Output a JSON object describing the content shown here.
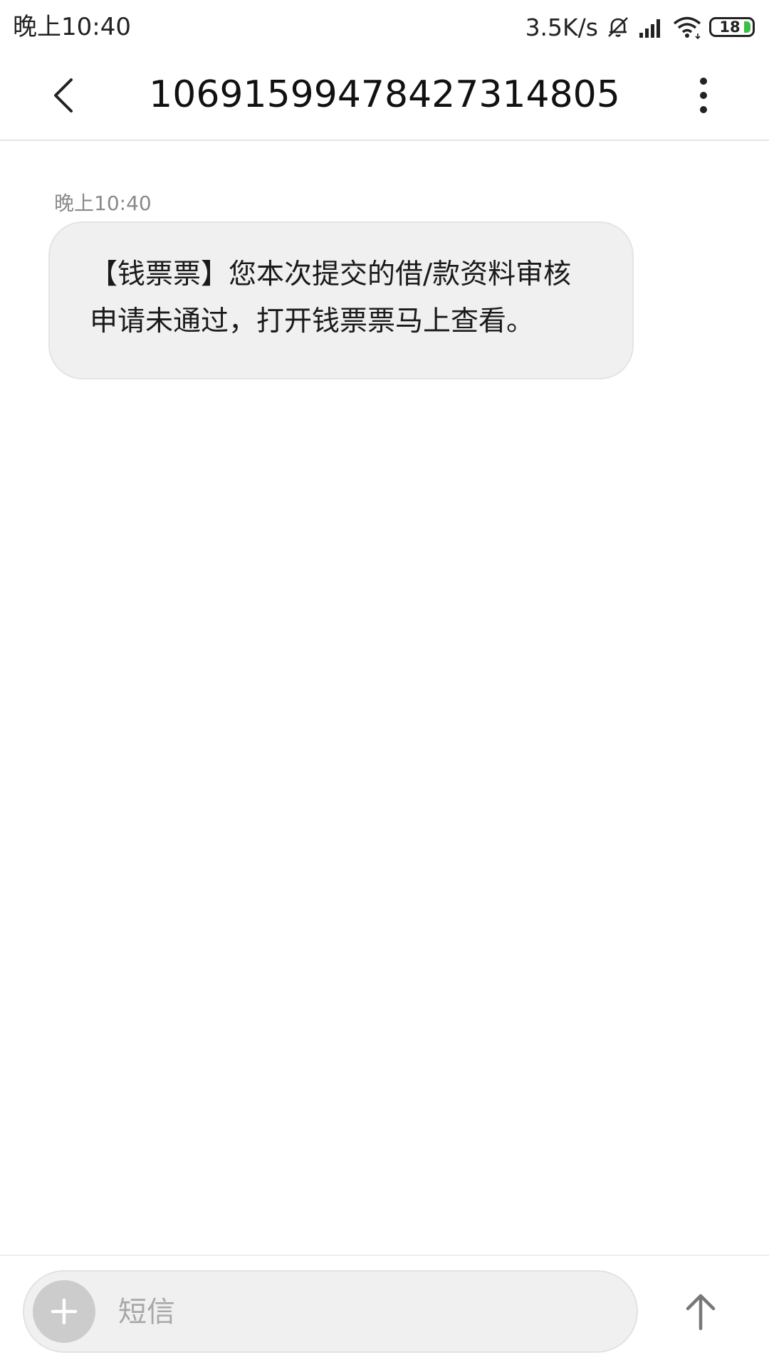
{
  "status_bar": {
    "time": "晚上10:40",
    "net_speed": "3.5K/s",
    "battery_level": "18",
    "icons": [
      "mute-bell-icon",
      "signal-icon",
      "wifi-icon",
      "battery-icon"
    ],
    "battery_color": "#3cbf45"
  },
  "header": {
    "title": "1069159947842731480​5",
    "back_icon": "chevron-left-icon",
    "more_icon": "more-vertical-icon"
  },
  "conversation": {
    "messages": [
      {
        "time": "晚上10:40",
        "text": "【钱票票】您本次提交的借/款资料审核申请未通过，打开钱票票马上查看。"
      }
    ]
  },
  "compose": {
    "placeholder": "短信",
    "value": "",
    "attach_icon": "plus-icon",
    "send_icon": "arrow-up-icon"
  }
}
